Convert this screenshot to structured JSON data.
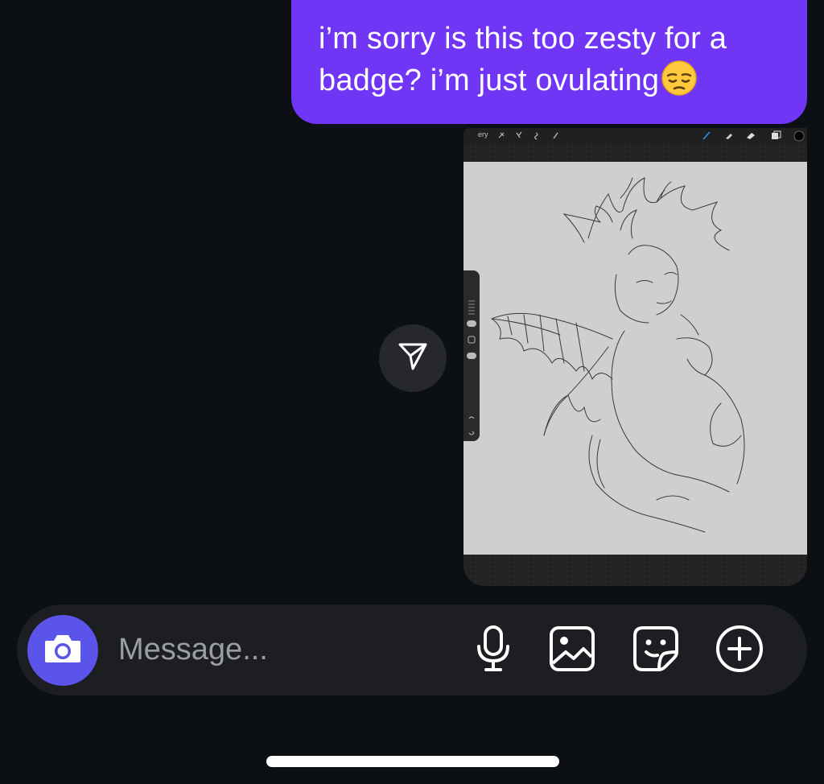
{
  "messages": [
    {
      "type": "text",
      "text": "i’m sorry is this too zesty for a badge? i’m just ovulating",
      "emoji": "pensive-face",
      "bubble_color": "#7035f5"
    },
    {
      "type": "image",
      "app": "procreate-sketch-screenshot",
      "toolbar_label": "ery"
    }
  ],
  "composer": {
    "placeholder": "Message...",
    "actions": [
      "camera-icon",
      "microphone-icon",
      "gallery-icon",
      "sticker-icon",
      "add-icon"
    ],
    "camera_color": "#5a54ea"
  },
  "share": {
    "icon": "send-icon"
  },
  "colors": {
    "background": "#0c1014",
    "composer": "#1c1e22"
  }
}
